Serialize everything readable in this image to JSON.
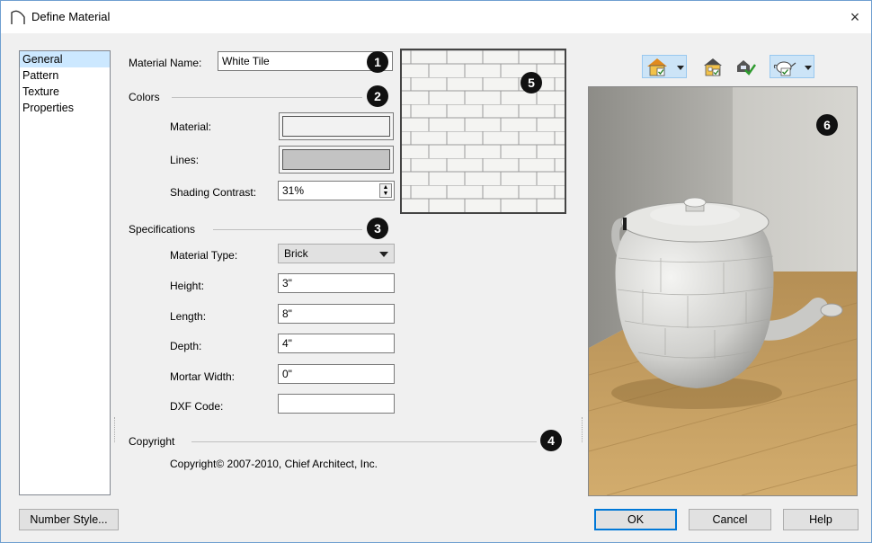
{
  "window": {
    "title": "Define Material",
    "close_label": "×"
  },
  "nav": {
    "items": [
      "General",
      "Pattern",
      "Texture",
      "Properties"
    ],
    "selected": "General"
  },
  "material_name": {
    "label": "Material Name:",
    "value": "White Tile"
  },
  "colors": {
    "heading": "Colors",
    "material_label": "Material:",
    "material_color": "#f2f2f2",
    "lines_label": "Lines:",
    "lines_color": "#c3c3c3",
    "shading_label": "Shading Contrast:",
    "shading_value": "31%"
  },
  "specs": {
    "heading": "Specifications",
    "type_label": "Material Type:",
    "type_value": "Brick",
    "height_label": "Height:",
    "height_value": "3\"",
    "length_label": "Length:",
    "length_value": "8\"",
    "depth_label": "Depth:",
    "depth_value": "4\"",
    "mortar_label": "Mortar Width:",
    "mortar_value": "0\"",
    "dxf_label": "DXF Code:",
    "dxf_value": ""
  },
  "copyright": {
    "heading": "Copyright",
    "text": "Copyright© 2007-2010, Chief Architect, Inc."
  },
  "callouts": [
    "1",
    "2",
    "3",
    "4",
    "5",
    "6"
  ],
  "toolbar": {
    "icons": [
      "house-view-icon",
      "elevation-view-icon",
      "render-check-icon",
      "teapot-object-icon"
    ]
  },
  "buttons": {
    "number_style": "Number Style...",
    "ok": "OK",
    "cancel": "Cancel",
    "help": "Help"
  }
}
